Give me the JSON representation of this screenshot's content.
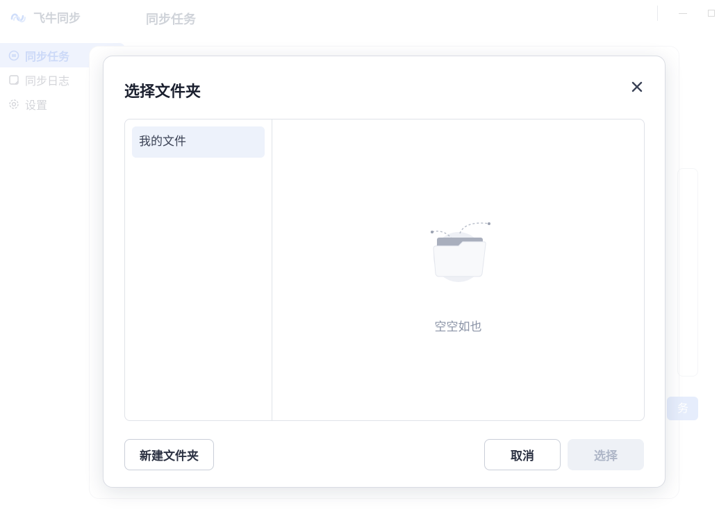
{
  "app": {
    "name": "飞牛同步",
    "page_title": "同步任务"
  },
  "sidebar": {
    "items": [
      {
        "label": "同步任务",
        "icon": "sync-task-icon",
        "active": true
      },
      {
        "label": "同步日志",
        "icon": "log-icon",
        "active": false
      },
      {
        "label": "设置",
        "icon": "gear-icon",
        "active": false
      }
    ]
  },
  "background": {
    "partial_button_text": "务"
  },
  "dialog": {
    "title": "选择文件夹",
    "close_icon": "close-icon",
    "tree": {
      "items": [
        {
          "label": "我的文件",
          "selected": true
        }
      ]
    },
    "empty_state": {
      "text": "空空如也",
      "icon": "empty-folder-illustration"
    },
    "buttons": {
      "new_folder": "新建文件夹",
      "cancel": "取消",
      "select": "选择"
    }
  },
  "colors": {
    "accent": "#1d56e0",
    "selected_bg": "#edf2fb",
    "disabled_bg": "#eef1f6",
    "disabled_text": "#aeb6c7"
  }
}
